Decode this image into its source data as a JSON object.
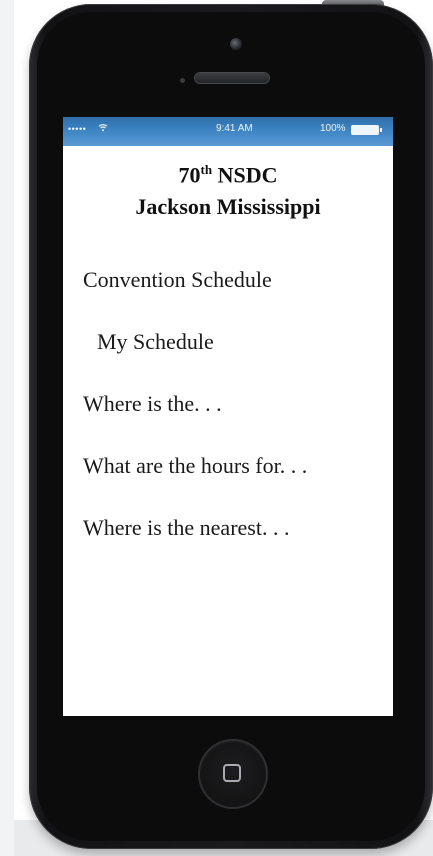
{
  "status_bar": {
    "signal": "•••••",
    "wifi": "ᯤ",
    "time": "9:41 AM",
    "battery_percent": "100%"
  },
  "header": {
    "edition_number": "70",
    "edition_suffix": "th",
    "event_name": "NSDC",
    "location": "Jackson Mississippi"
  },
  "menu": {
    "items": [
      {
        "label": "Convention Schedule"
      },
      {
        "label": "My Schedule"
      },
      {
        "label": "Where is the. . ."
      },
      {
        "label": "What are the hours for. . ."
      },
      {
        "label": "Where is the nearest. . ."
      }
    ]
  },
  "colors": {
    "status_bar": "#3d84c3",
    "phone_body": "#1a1a1c",
    "screen": "#ffffff",
    "text": "#1a1a1a"
  },
  "icons": {
    "wifi": "wifi-icon",
    "battery": "battery-icon",
    "home": "home-button-icon"
  }
}
